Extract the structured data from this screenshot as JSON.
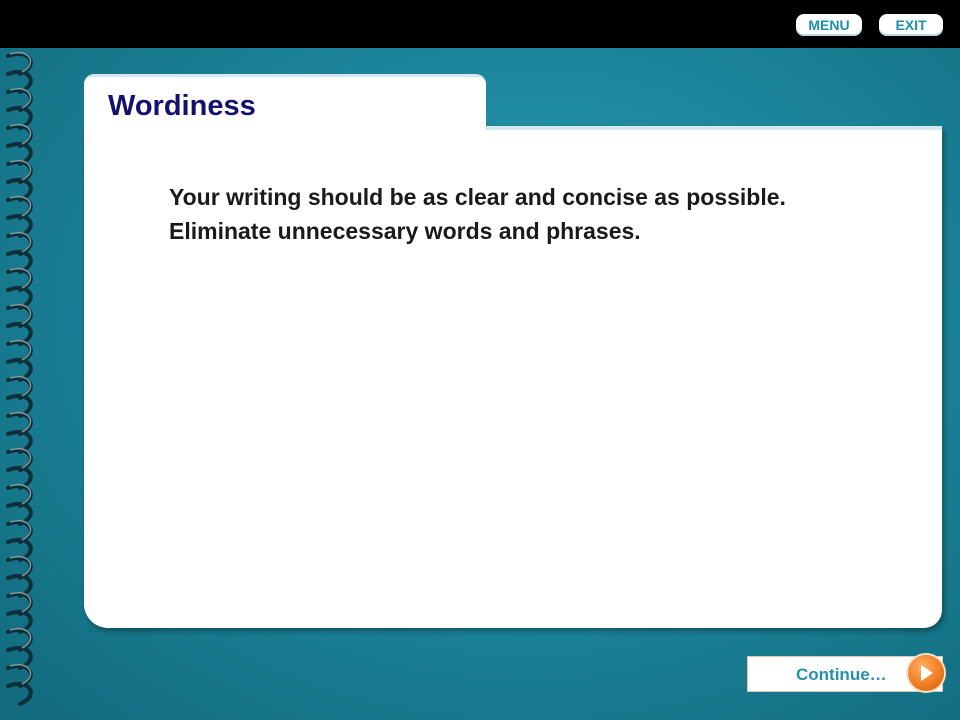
{
  "nav": {
    "menu_label": "MENU",
    "exit_label": "EXIT"
  },
  "slide": {
    "title": "Wordiness",
    "body": "Your writing should be as clear and concise as possible. Eliminate unnecessary words and phrases."
  },
  "footer": {
    "continue_label": "Continue…",
    "continue_icon": "arrow-right-icon"
  },
  "colors": {
    "background_teal": "#1c869c",
    "title_navy": "#12126e",
    "button_text_blue": "#2590ad",
    "arrow_orange": "#f07d22"
  }
}
